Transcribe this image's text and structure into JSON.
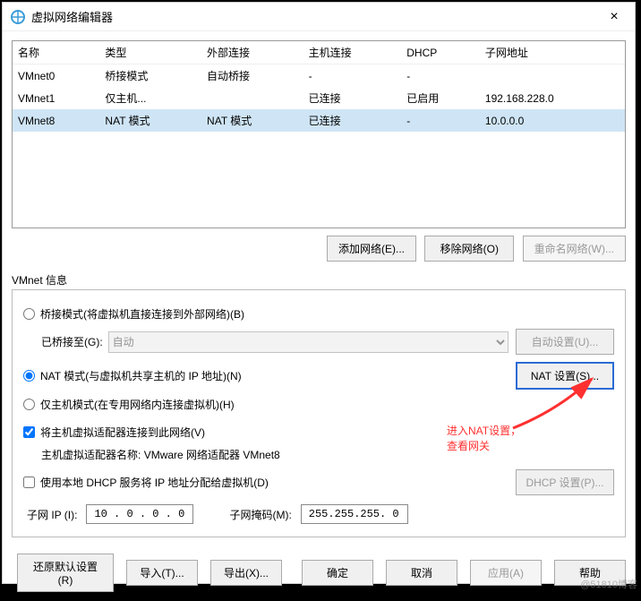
{
  "window": {
    "title": "虚拟网络编辑器",
    "close": "×"
  },
  "table": {
    "headers": {
      "name": "名称",
      "type": "类型",
      "ext": "外部连接",
      "host": "主机连接",
      "dhcp": "DHCP",
      "subnet": "子网地址"
    },
    "rows": [
      {
        "name": "VMnet0",
        "type": "桥接模式",
        "ext": "自动桥接",
        "host": "-",
        "dhcp": "-",
        "subnet": ""
      },
      {
        "name": "VMnet1",
        "type": "仅主机...",
        "ext": "",
        "host": "已连接",
        "dhcp": "已启用",
        "subnet": "192.168.228.0"
      },
      {
        "name": "VMnet8",
        "type": "NAT 模式",
        "ext": "NAT 模式",
        "host": "已连接",
        "dhcp": "-",
        "subnet": "10.0.0.0"
      }
    ]
  },
  "buttons": {
    "add_net": "添加网络(E)...",
    "remove_net": "移除网络(O)",
    "rename_net": "重命名网络(W)...",
    "auto_settings": "自动设置(U)...",
    "nat_settings": "NAT 设置(S)...",
    "dhcp_settings": "DHCP 设置(P)...",
    "restore": "还原默认设置(R)",
    "import": "导入(T)...",
    "export": "导出(X)...",
    "ok": "确定",
    "cancel": "取消",
    "apply": "应用(A)",
    "help": "帮助"
  },
  "info": {
    "section_label": "VMnet 信息",
    "bridge_label": "桥接模式(将虚拟机直接连接到外部网络)(B)",
    "bridged_to": "已桥接至(G):",
    "bridged_value": "自动",
    "nat_label": "NAT 模式(与虚拟机共享主机的 IP 地址)(N)",
    "hostonly_label": "仅主机模式(在专用网络内连接虚拟机)(H)",
    "connect_adapter": "将主机虚拟适配器连接到此网络(V)",
    "adapter_name_label": "主机虚拟适配器名称:",
    "adapter_name_value": "VMware 网络适配器 VMnet8",
    "use_dhcp": "使用本地 DHCP 服务将 IP 地址分配给虚拟机(D)",
    "subnet_ip_label": "子网 IP (I):",
    "subnet_ip_value": "10 . 0 . 0 . 0",
    "subnet_mask_label": "子网掩码(M):",
    "subnet_mask_value": "255.255.255. 0"
  },
  "annotation": {
    "line1": "进入NAT设置，",
    "line2": "查看网关"
  },
  "watermark": "@51810博客"
}
